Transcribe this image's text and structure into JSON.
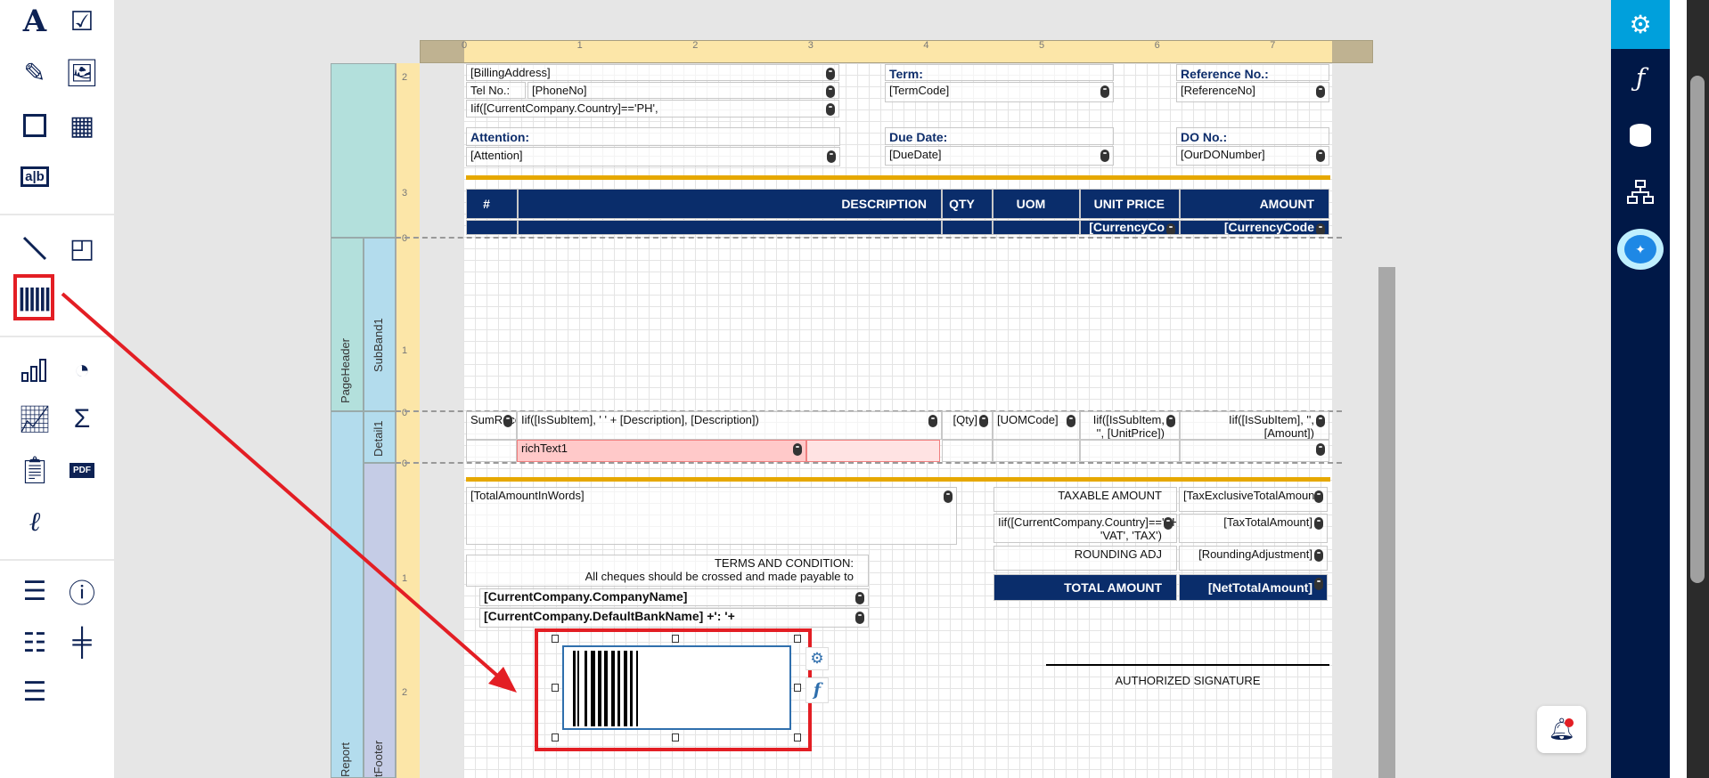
{
  "toolbar": {
    "items": [
      "text-icon",
      "checkbox-icon",
      "edit-icon",
      "image-icon",
      "rectangle-icon",
      "table-icon",
      "ab-field-icon",
      "line-icon",
      "shapes-icon",
      "barcode-icon",
      "bar-chart-icon",
      "gauge-icon",
      "line-chart-icon",
      "sigma-icon",
      "clipboard-icon",
      "pdf-icon",
      "signature-icon",
      "list-icon",
      "page-info-icon",
      "band-icon",
      "split-band-icon",
      "band-resize-icon"
    ],
    "selected": "barcode-icon",
    "pdf_label": "PDF",
    "highlight_color": "#e31e24"
  },
  "right_panel": {
    "items": [
      "gear-icon",
      "function-icon",
      "database-icon",
      "hierarchy-icon",
      "ai-chat-icon"
    ],
    "active": "gear-icon",
    "active_color": "#00a0dc"
  },
  "ruler": {
    "h": [
      "0",
      "1",
      "2",
      "3",
      "4",
      "5",
      "6",
      "7"
    ],
    "v": [
      "2",
      "3",
      "0",
      "1",
      "0",
      "0",
      "1",
      "2"
    ]
  },
  "bands": {
    "page_header": "PageHeader",
    "sub_band": "SubBand1",
    "detail": "Detail1",
    "report": "Report",
    "report_footer": "tFooter"
  },
  "header": {
    "billing_address": "[BillingAddress]",
    "tel_label": "Tel No.:",
    "phone": "[PhoneNo]",
    "country_expr": "Iif([CurrentCompany.Country]=='PH',",
    "term_label": "Term:",
    "term_code": "[TermCode]",
    "ref_label": "Reference No.:",
    "ref_no": "[ReferenceNo]",
    "attention_label": "Attention:",
    "attention": "[Attention]",
    "due_label": "Due Date:",
    "due_date": "[DueDate]",
    "do_label": "DO No.:",
    "do_no": "[OurDONumber]"
  },
  "table": {
    "columns": [
      "#",
      "DESCRIPTION",
      "QTY",
      "UOM",
      "UNIT PRICE",
      "AMOUNT"
    ],
    "currency1": "[CurrencyCo",
    "currency2": "[CurrencyCode"
  },
  "detail": {
    "rec": "SumRecordNu",
    "desc": "Iif([IsSubItem], '   ' + [Description], [Description])",
    "qty": "[Qty]",
    "uom": "[UOMCode]",
    "unit_price": "Iif([IsSubItem, '', [UnitPrice])",
    "amount": "Iif([IsSubItem], '', [Amount])",
    "rich_text": "richText1"
  },
  "footer": {
    "amount_words": "[TotalAmountInWords]",
    "terms_title": "TERMS AND CONDITION:",
    "terms_text": "All cheques should be crossed and made payable to",
    "company_name": "[CurrentCompany.CompanyName]",
    "bank_name": "[CurrentCompany.DefaultBankName] +': '+",
    "taxable_label": "TAXABLE AMOUNT",
    "taxable_value": "[TaxExclusiveTotalAmount]",
    "tax_label": "Iif([CurrentCompany.Country]=='PH', 'VAT', 'TAX')",
    "tax_value": "[TaxTotalAmount]",
    "rounding_label": "ROUNDING ADJ",
    "rounding_value": "[RoundingAdjustment]",
    "total_label": "TOTAL AMOUNT",
    "total_value": "[NetTotalAmount]",
    "signature": "AUTHORIZED SIGNATURE"
  },
  "barcode": {
    "selected": true,
    "actions": [
      "gear-icon",
      "function-icon"
    ]
  }
}
